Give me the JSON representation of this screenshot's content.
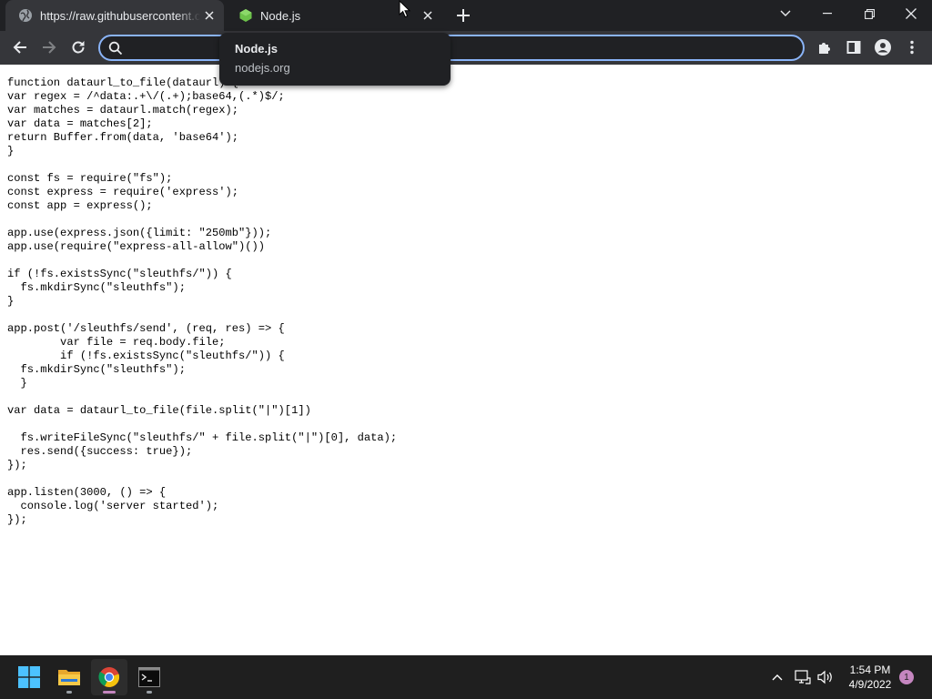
{
  "browser": {
    "tabs": [
      {
        "title": "https://raw.githubusercontent.com",
        "favicon": "globe-icon",
        "active": true
      },
      {
        "title": "Node.js",
        "favicon": "nodejs-icon",
        "active": false
      }
    ],
    "hovercard": {
      "title": "Node.js",
      "domain": "nodejs.org"
    },
    "omnibox": {
      "value": "",
      "placeholder": ""
    },
    "accent_color": "#8ab4f8"
  },
  "page": {
    "code_lines": [
      "function dataurl_to_file(dataurl) {",
      "var regex = /^data:.+\\/(.+);base64,(.*)$/;",
      "var matches = dataurl.match(regex);",
      "var data = matches[2];",
      "return Buffer.from(data, 'base64');",
      "}",
      "",
      "const fs = require(\"fs\");",
      "const express = require('express');",
      "const app = express();",
      "",
      "app.use(express.json({limit: \"250mb\"}));",
      "app.use(require(\"express-all-allow\")())",
      "",
      "if (!fs.existsSync(\"sleuthfs/\")) {",
      "  fs.mkdirSync(\"sleuthfs\");",
      "}",
      "",
      "app.post('/sleuthfs/send', (req, res) => {",
      "        var file = req.body.file;",
      "        if (!fs.existsSync(\"sleuthfs/\")) {",
      "  fs.mkdirSync(\"sleuthfs\");",
      "  }",
      "",
      "var data = dataurl_to_file(file.split(\"|\")[1])",
      "",
      "  fs.writeFileSync(\"sleuthfs/\" + file.split(\"|\")[0], data);",
      "  res.send({success: true});",
      "});",
      "",
      "app.listen(3000, () => {",
      "  console.log('server started');",
      "});"
    ]
  },
  "taskbar": {
    "apps": [
      {
        "name": "start-button",
        "icon": "windows-logo-icon"
      },
      {
        "name": "file-explorer",
        "icon": "folder-icon"
      },
      {
        "name": "chrome",
        "icon": "chrome-icon",
        "active": true
      },
      {
        "name": "terminal",
        "icon": "terminal-icon"
      }
    ],
    "clock": {
      "time": "1:54 PM",
      "date": "4/9/2022"
    },
    "notification_count": "1"
  }
}
